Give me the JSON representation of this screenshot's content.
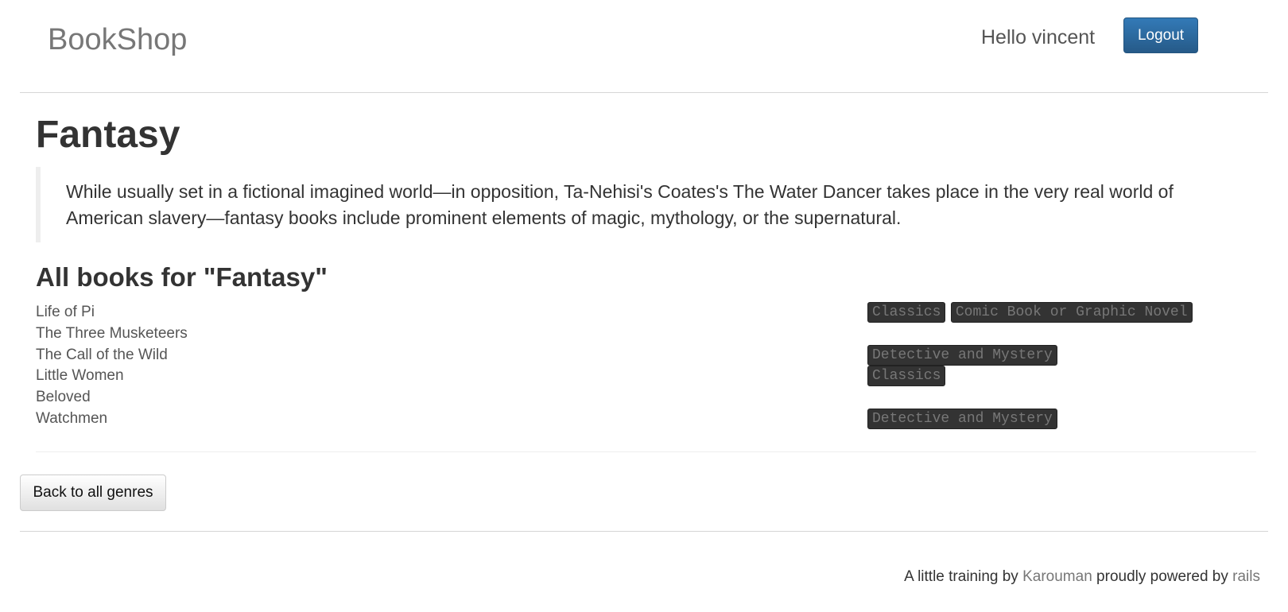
{
  "navbar": {
    "brand": "BookShop",
    "greeting": "Hello vincent",
    "logout_label": "Logout"
  },
  "genre": {
    "title": "Fantasy",
    "description": "While usually set in a fictional imagined world—in opposition, Ta-Nehisi's Coates's The Water Dancer takes place in the very real world of American slavery—fantasy books include prominent elements of magic, mythology, or the supernatural."
  },
  "books_section": {
    "title": "All books for \"Fantasy\"",
    "books": [
      {
        "title": "Life of Pi",
        "tags": [
          "Classics",
          "Comic Book or Graphic Novel"
        ]
      },
      {
        "title": "The Three Musketeers",
        "tags": []
      },
      {
        "title": "The Call of the Wild",
        "tags": [
          "Detective and Mystery"
        ]
      },
      {
        "title": "Little Women",
        "tags": [
          "Classics"
        ]
      },
      {
        "title": "Beloved",
        "tags": []
      },
      {
        "title": "Watchmen",
        "tags": [
          "Detective and Mystery"
        ]
      }
    ]
  },
  "back_button_label": "Back to all genres",
  "footer": {
    "prefix": "A little training by ",
    "author_link": "Karouman",
    "middle": " proudly powered by ",
    "framework_link": "rails"
  },
  "colors": {
    "primary_button": "#337ab7",
    "tag_background": "#333333",
    "tag_text": "#777777",
    "link": "#777777"
  }
}
